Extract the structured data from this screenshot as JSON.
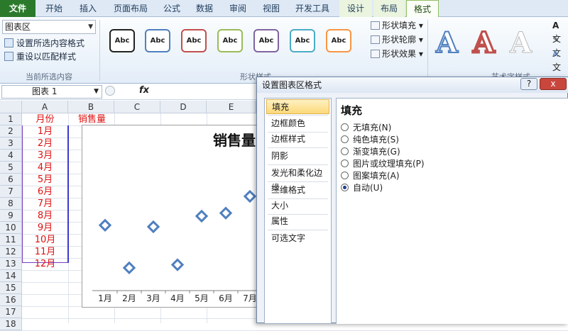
{
  "tabs": [
    "文件",
    "开始",
    "插入",
    "页面布局",
    "公式",
    "数据",
    "审阅",
    "视图",
    "开发工具",
    "设计",
    "布局",
    "格式"
  ],
  "ribbon": {
    "selector_value": "图表区",
    "format_selection": "设置所选内容格式",
    "reset_style": "重设以匹配样式",
    "group_current": "当前所选内容",
    "shape_sample": "Abc",
    "shape_fill": "形状填充",
    "shape_outline": "形状轮廓",
    "shape_effects": "形状效果",
    "group_shape_styles": "形状样式",
    "group_wordart": "艺术字样式",
    "wordart_letter": "A",
    "text_small": "文"
  },
  "formula_bar": {
    "name": "图表 1",
    "fx": "fx"
  },
  "columns": [
    "A",
    "B",
    "C",
    "D",
    "E"
  ],
  "rows": [
    "1",
    "2",
    "3",
    "4",
    "5",
    "6",
    "7",
    "8",
    "9",
    "10",
    "11",
    "12",
    "13",
    "14",
    "15",
    "16",
    "17",
    "18"
  ],
  "cells": {
    "A1": "月份",
    "B1": "销售量"
  },
  "months": [
    "1月",
    "2月",
    "3月",
    "4月",
    "5月",
    "6月",
    "7月",
    "8月",
    "9月",
    "10月",
    "11月",
    "12月"
  ],
  "chart_data": {
    "type": "scatter",
    "title": "销售量",
    "categories": [
      "1月",
      "2月",
      "3月",
      "4月",
      "5月",
      "6月",
      "7月"
    ],
    "values": [
      43,
      15,
      42,
      17,
      49,
      51,
      62
    ],
    "ylim": [
      0,
      90
    ]
  },
  "dialog": {
    "title": "设置图表区格式",
    "help": "?",
    "close": "x",
    "nav": [
      "填充",
      "边框颜色",
      "边框样式",
      "阴影",
      "发光和柔化边缘",
      "三维格式",
      "大小",
      "属性",
      "可选文字"
    ],
    "section": "填充",
    "options": [
      "无填充(N)",
      "纯色填充(S)",
      "渐变填充(G)",
      "图片或纹理填充(P)",
      "图案填充(A)",
      "自动(U)"
    ],
    "selected": "自动(U)"
  },
  "colors": {
    "accent": "#2b7a2b",
    "series": "#4f7fbf",
    "red_text": "#dd1111"
  }
}
